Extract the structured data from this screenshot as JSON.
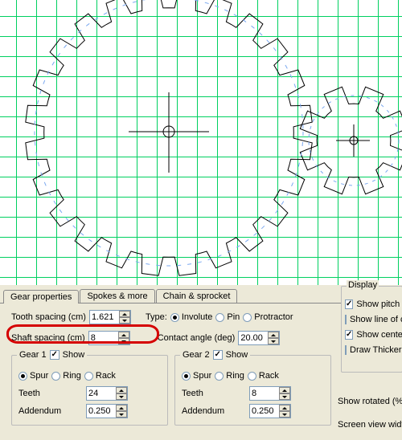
{
  "tabs": {
    "gear_properties": "Gear properties",
    "spokes_more": "Spokes & more",
    "chain_sprocket": "Chain & sprocket"
  },
  "top_row": {
    "tooth_spacing_label": "Tooth spacing (cm)",
    "tooth_spacing_value": "1.621",
    "type_label": "Type:",
    "type_options": {
      "involute": "Involute",
      "pin": "Pin",
      "protractor": "Protractor"
    },
    "type_selected": "involute"
  },
  "second_row": {
    "shaft_spacing_label": "Shaft spacing (cm)",
    "shaft_spacing_value": "8",
    "contact_angle_label": "Contact angle (deg)",
    "contact_angle_value": "20.00"
  },
  "gear1": {
    "legend": "Gear 1",
    "show_label": "Show",
    "show_checked": true,
    "mode_options": {
      "spur": "Spur",
      "ring": "Ring",
      "rack": "Rack"
    },
    "mode_selected": "spur",
    "teeth_label": "Teeth",
    "teeth_value": "24",
    "addendum_label": "Addendum",
    "addendum_value": "0.250"
  },
  "gear2": {
    "legend": "Gear 2",
    "show_label": "Show",
    "show_checked": true,
    "mode_options": {
      "spur": "Spur",
      "ring": "Ring",
      "rack": "Rack"
    },
    "mode_selected": "spur",
    "teeth_label": "Teeth",
    "teeth_value": "8",
    "addendum_label": "Addendum",
    "addendum_value": "0.250"
  },
  "display": {
    "legend": "Display",
    "show_pitch": {
      "label": "Show pitch d",
      "checked": true
    },
    "show_line": {
      "label": "Show line of c",
      "checked": false
    },
    "show_center": {
      "label": "Show center",
      "checked": true
    },
    "draw_thicker": {
      "label": "Draw Thicker",
      "checked": false
    }
  },
  "footer": {
    "show_rotated": "Show rotated (% o",
    "screen_view": "Screen view width"
  }
}
